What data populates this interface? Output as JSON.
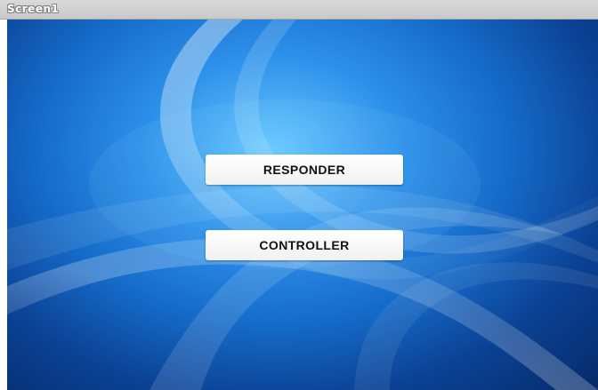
{
  "window": {
    "title": "Screen1"
  },
  "screen": {
    "background_colors": {
      "light": "#68c8ff",
      "mid": "#156ac8",
      "dark": "#062b68"
    }
  },
  "buttons": {
    "responder_label": "RESPONDER",
    "controller_label": "CONTROLLER"
  }
}
